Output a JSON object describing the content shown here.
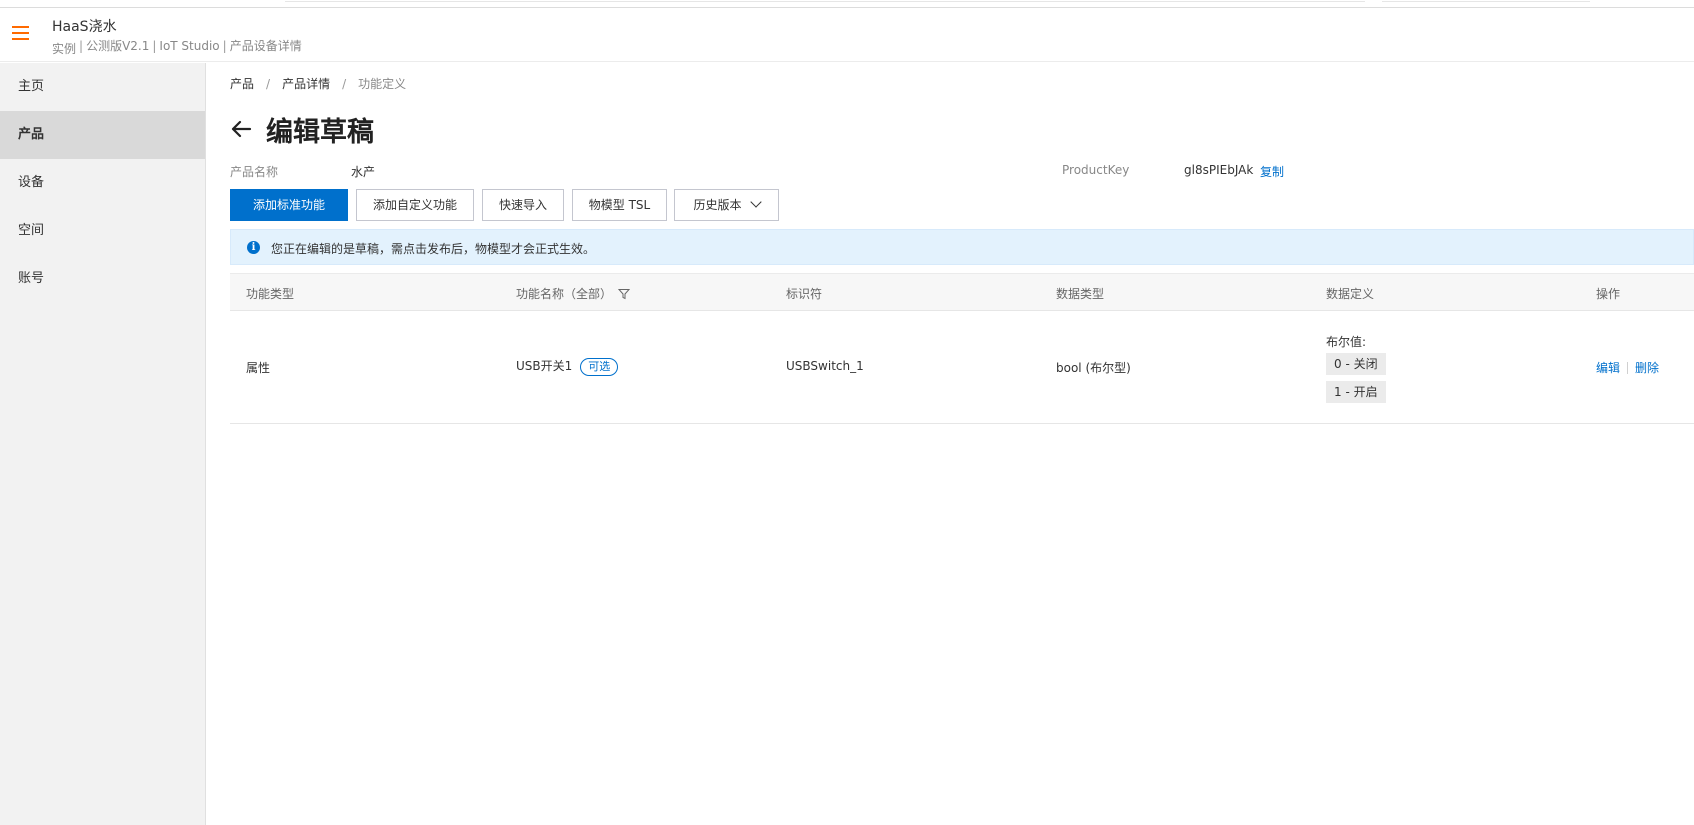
{
  "header": {
    "app_title": "HaaS浇水",
    "sub_instance": "实例",
    "sub_version": "公测版V2.1",
    "sub_studio": "IoT Studio",
    "sub_page": "产品设备详情",
    "separator": "|"
  },
  "sidebar": {
    "items": [
      {
        "label": "主页"
      },
      {
        "label": "产品"
      },
      {
        "label": "设备"
      },
      {
        "label": "空间"
      },
      {
        "label": "账号"
      }
    ],
    "active_index": 1
  },
  "breadcrumb": {
    "items": [
      "产品",
      "产品详情",
      "功能定义"
    ],
    "separator": "/"
  },
  "page": {
    "title": "编辑草稿",
    "product_name_label": "产品名称",
    "product_name_value": "水产",
    "product_key_label": "ProductKey",
    "product_key_value": "gl8sPIEbJAk",
    "copy_label": "复制"
  },
  "toolbar": {
    "add_standard": "添加标准功能",
    "add_custom": "添加自定义功能",
    "quick_import": "快速导入",
    "tsl_model": "物模型 TSL",
    "history": "历史版本"
  },
  "notice": {
    "text": "您正在编辑的是草稿，需点击发布后，物模型才会正式生效。"
  },
  "table": {
    "headers": {
      "type": "功能类型",
      "name": "功能名称（全部）",
      "identifier": "标识符",
      "data_type": "数据类型",
      "data_def": "数据定义",
      "actions": "操作"
    },
    "rows": [
      {
        "type": "属性",
        "name": "USB开关1",
        "tag": "可选",
        "identifier": "USBSwitch_1",
        "data_type": "bool (布尔型)",
        "def_title": "布尔值:",
        "def_values": [
          "0 - 关闭",
          "1 - 开启"
        ],
        "edit": "编辑",
        "delete": "删除"
      }
    ]
  },
  "colors": {
    "accent": "#0070cc",
    "hamburger": "#ff6a00",
    "notice_bg": "#e3f2fd"
  }
}
